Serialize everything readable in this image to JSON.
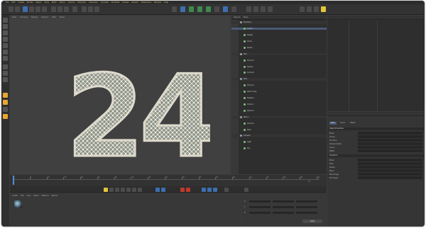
{
  "app": {
    "menu": [
      "File",
      "Edit",
      "Create",
      "Modes",
      "Select",
      "Tools",
      "Mesh",
      "Spline",
      "Volume",
      "MoGraph",
      "Character",
      "Animate",
      "Simulate",
      "Tracker",
      "Render",
      "Extensions",
      "Window",
      "Help"
    ]
  },
  "viewport": {
    "menu": [
      "View",
      "Cameras",
      "Display",
      "Options",
      "Filter",
      "Panel"
    ],
    "numeral_text": "24",
    "accent_color": "#c9c9b4"
  },
  "object_manager": {
    "tabs": [
      "Objects",
      "Takes"
    ],
    "rows": [
      {
        "label": "Numbers",
        "type": "group"
      },
      {
        "label": "Cloner",
        "type": "sel"
      },
      {
        "label": "Sweep",
        "type": "item"
      },
      {
        "label": "Circle",
        "type": "item"
      },
      {
        "label": "Spline",
        "type": "item"
      },
      {
        "label": "Null",
        "type": "group"
      },
      {
        "label": "Cloner.1",
        "type": "item"
      },
      {
        "label": "Sphere",
        "type": "item"
      },
      {
        "label": "Connect",
        "type": "item"
      },
      {
        "label": "Text",
        "type": "group"
      },
      {
        "label": "Cloner.2",
        "type": "item"
      },
      {
        "label": "Atom Array",
        "type": "item"
      },
      {
        "label": "Sweep.1",
        "type": "item"
      },
      {
        "label": "Circle.1",
        "type": "item"
      },
      {
        "label": "Spline.1",
        "type": "item"
      },
      {
        "label": "Null.1",
        "type": "group"
      },
      {
        "label": "Cloner.3",
        "type": "item"
      },
      {
        "label": "Plain",
        "type": "item"
      },
      {
        "label": "Camera",
        "type": "group"
      },
      {
        "label": "Light",
        "type": "item"
      },
      {
        "label": "Sky",
        "type": "item"
      }
    ]
  },
  "attributes": {
    "tabs": [
      "Basic",
      "Coord.",
      "Object"
    ],
    "sections": [
      "Object Properties",
      "Transform"
    ],
    "rows": [
      "Mode",
      "Clones",
      "Fix Clone",
      "Instance Mode",
      "Count",
      "Offset",
      "Mode",
      "Total",
      "Radius",
      "Plane",
      "Start Angle",
      "End Angle"
    ]
  },
  "timeline": {
    "frames": [
      "0",
      "5",
      "10",
      "15",
      "20",
      "25",
      "30",
      "35",
      "40",
      "45",
      "50",
      "55",
      "60",
      "65",
      "70",
      "75",
      "80",
      "85",
      "90"
    ],
    "current_frame": "0 F"
  },
  "material_manager": {
    "menu": [
      "Create",
      "Edit",
      "View",
      "Select",
      "Material",
      "Texture"
    ]
  },
  "coordinates": {
    "axes": [
      "X",
      "Y",
      "Z"
    ],
    "apply_label": "Apply"
  }
}
